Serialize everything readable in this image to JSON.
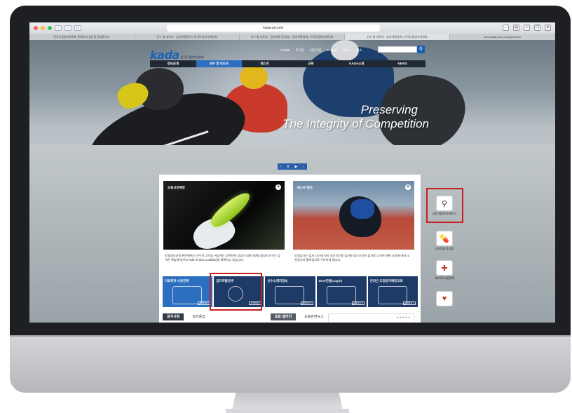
{
  "browser": {
    "url": "kada-ad.or.kr",
    "tabs": [
      "한국도핑방지위원회 홈페이지 방문을 환영합니다",
      "선수 및 지도자 › 금지약물검색 | 한국도핑방지위원회",
      "선수 및 지도자 › 금지약물 및 방법 › 금지약물검색 | 한국도핑방지위원회",
      "선수 및 지도자 › 금지약물검색 | 한국도핑방지위원회",
      "www.kada-ad.or.kr/page/1/0/9"
    ]
  },
  "site": {
    "logo": {
      "main": "kada",
      "sub": "한국도핑방지위원회"
    },
    "util": [
      "HOME",
      "로그인",
      "회원가입",
      "English",
      "확대+",
      "축소-"
    ],
    "gnb": [
      "정보공개",
      "선수 및 지도자",
      "테스트",
      "교육",
      "KADA소개",
      "NEWS"
    ],
    "gnb_active": "선수 및 지도자",
    "slogan": {
      "line1": "Preserving",
      "line2": "The Integrity of Competition"
    },
    "slider_controls": {
      "prev": "‹",
      "pause": "II",
      "play": "▶",
      "next": "›"
    },
    "cards": [
      {
        "title": "도핑사전예방",
        "text": "도핑방지규정 위반행위는 선수의 고의성 여부에는 무관하게 성립이 되며 세계도핑방지기구는 엄격한 책임원칙(The Rule of Strict Liability)을 채택하고 있습니다."
      },
      {
        "title": "테스트 절차",
        "text": "도핑검사는 검사 시기에 따라 경기기간중 검사와 경기기간외 검사로 나뉘며 채취 시료에 따라 소변검사와 혈액검사로 구분하게 됩니다."
      }
    ],
    "menus": [
      {
        "label": "치료목적 사용면제",
        "button": "자세히보기"
      },
      {
        "label": "금지약물검색",
        "button": "자세히보기"
      },
      {
        "label": "선수소재지정보",
        "button": "자세히보기"
      },
      {
        "label": "DCO전용(Login)",
        "button": "자세히보기"
      },
      {
        "label": "온라인 도핑방지예방교육",
        "button": "자세히보기"
      }
    ],
    "bottom_tabs": [
      "공지사항",
      "질의응답",
      "포토 갤러리",
      "도핑관련뉴스"
    ],
    "pager_dots": "●●●●●",
    "quick_menu": [
      {
        "label": "금지약물데이터베이스",
        "icon": "magnifier-icon"
      },
      {
        "label": "금지약물 및 방법",
        "icon": "pills-icon"
      },
      {
        "label": "치료목적사용면제",
        "icon": "medicine-box-icon"
      },
      {
        "label": "",
        "icon": "calendar-heart-icon"
      }
    ]
  },
  "colors": {
    "brand_blue": "#1a63b5",
    "nav_dark": "#202833",
    "menu_navy": "#1e3a66",
    "highlight_red": "#c71e1e"
  }
}
